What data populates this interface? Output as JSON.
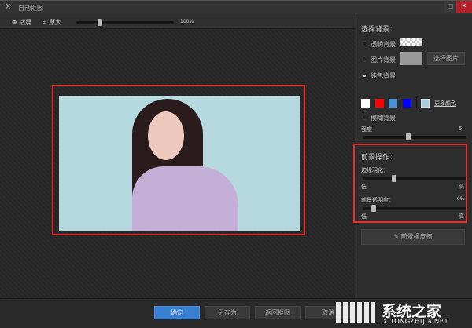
{
  "window": {
    "title": "自动抠图",
    "maximize_icon": "maximize-icon",
    "close_icon": "close-icon",
    "close_color": "#b3202a"
  },
  "toolbar": {
    "fit_label": "适屏",
    "original_label": "原大",
    "zoom_value": "100%",
    "zoom_percent": 100,
    "zoom_slider_fraction": 0.2
  },
  "canvas": {
    "photo_bg_color": "#b6d8df",
    "highlight_color": "#e03030"
  },
  "panel": {
    "bg_title": "选择背景：",
    "transparent_label": "透明背景",
    "image_label": "图片背景",
    "choose_image": "选择图片",
    "solid_label": "纯色背景",
    "colors": [
      "#ffffff",
      "#ff0000",
      "#4a90d9",
      "#0000ff"
    ],
    "custom_color": "#a6cfe0",
    "more_colors": "更多颜色",
    "blur_label": "模糊背景",
    "strength_label": "强度",
    "strength_value": "5",
    "strength_fraction": 0.5,
    "selected_bg": "纯色背景",
    "fg_title": "前景操作：",
    "feather_label": "边缘羽化：",
    "feather_fraction": 0.3,
    "low": "低",
    "high": "高",
    "opacity_label": "前景透明度：",
    "opacity_value": "0%",
    "opacity_fraction": 0.1,
    "eraser_label": "前景橡皮擦"
  },
  "bottom": {
    "ok": "确定",
    "save_as": "另存为",
    "back": "返回抠图",
    "cancel": "取消"
  },
  "watermark": {
    "text": "系统之家",
    "url": "XITONGZHIJIA.NET"
  }
}
